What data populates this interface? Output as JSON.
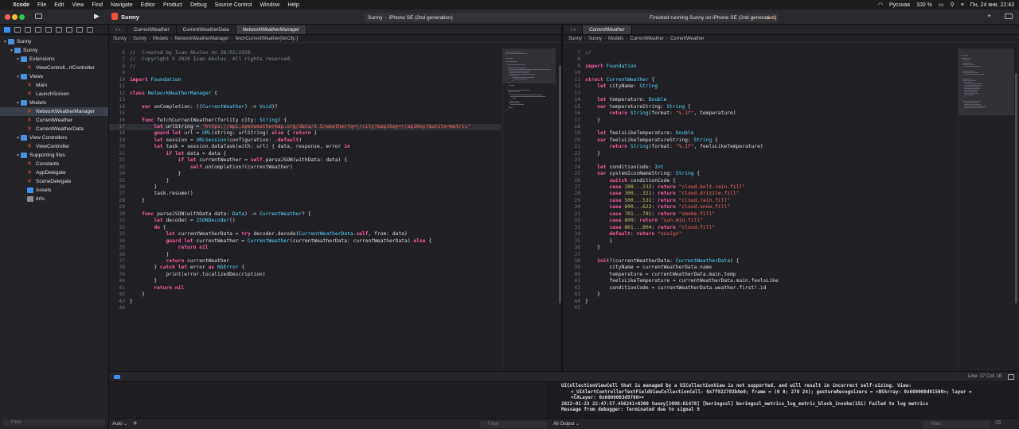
{
  "menubar": {
    "items": [
      "Xcode",
      "File",
      "Edit",
      "View",
      "Find",
      "Navigate",
      "Editor",
      "Product",
      "Debug",
      "Source Control",
      "Window",
      "Help"
    ],
    "status": {
      "input_source": "Русская",
      "battery": "100 %",
      "datetime": "Пн, 24 янв.  22:43"
    }
  },
  "toolbar": {
    "project": "Sunny",
    "scheme": "Sunny",
    "device": "iPhone SE (2nd generation)",
    "run_status": "Finished running Sunny on iPhone SE (2nd generation)",
    "warning_count": "1"
  },
  "navigator": {
    "tree": [
      {
        "label": "Sunny",
        "depth": 0,
        "kind": "proj",
        "open": true
      },
      {
        "label": "Sunny",
        "depth": 1,
        "kind": "folder",
        "open": true
      },
      {
        "label": "Extensions",
        "depth": 2,
        "kind": "folder",
        "open": true
      },
      {
        "label": "ViewControll...rtController",
        "depth": 3,
        "kind": "swift"
      },
      {
        "label": "Views",
        "depth": 2,
        "kind": "folder",
        "open": true
      },
      {
        "label": "Main",
        "depth": 3,
        "kind": "swift"
      },
      {
        "label": "LaunchScreen",
        "depth": 3,
        "kind": "swift"
      },
      {
        "label": "Models",
        "depth": 2,
        "kind": "folder",
        "open": true
      },
      {
        "label": "NetworkWeatherManager",
        "depth": 3,
        "kind": "swift",
        "selected": true
      },
      {
        "label": "CurrentWeather",
        "depth": 3,
        "kind": "swift"
      },
      {
        "label": "CurrentWeatherData",
        "depth": 3,
        "kind": "swift"
      },
      {
        "label": "View Controllers",
        "depth": 2,
        "kind": "folder",
        "open": true
      },
      {
        "label": "ViewController",
        "depth": 3,
        "kind": "swift"
      },
      {
        "label": "Supporting files",
        "depth": 2,
        "kind": "folder",
        "open": true
      },
      {
        "label": "Constants",
        "depth": 3,
        "kind": "swift"
      },
      {
        "label": "AppDelegate",
        "depth": 3,
        "kind": "swift"
      },
      {
        "label": "SceneDelegate",
        "depth": 3,
        "kind": "swift"
      },
      {
        "label": "Assets",
        "depth": 3,
        "kind": "assets"
      },
      {
        "label": "Info",
        "depth": 3,
        "kind": "plist"
      }
    ],
    "filter_placeholder": "Filter"
  },
  "left_editor": {
    "tabs": [
      "CurrentWeather",
      "CurrentWeatherData",
      "NetworkWeatherManager"
    ],
    "active_tab": 2,
    "breadcrumb": [
      "Sunny",
      "Sunny",
      "Models",
      "NetworkWeatherManager",
      "fetchCurrentWeather(forCity:)"
    ],
    "first_line": 6,
    "current_line": 17,
    "lines": [
      "//  Created by Ivan Akulov on 28/02/2020.",
      "//  Copyright © 2020 Ivan Akulov. All rights reserved.",
      "//",
      "",
      "import Foundation",
      "",
      "class NetworkWeatherManager {",
      "",
      "    var onCompletion: ((CurrentWeather) -> Void)?",
      "",
      "    func fetchCurrentWeather(forCity city: String) {",
      "        let urlString = \"https://api.openweathermap.org/data/2.5/weather?q=\\(city)&apikey=\\(apiKey)&units=metric\"",
      "        guard let url = URL(string: urlString) else { return }",
      "        let session = URLSession(configuration: .default)",
      "        let task = session.dataTask(with: url) { data, response, error in",
      "            if let data = data {",
      "                if let currentWeather = self.parseJSON(withData: data) {",
      "                    self.onCompletion?(currentWeather)",
      "                }",
      "            }",
      "        }",
      "        task.resume()",
      "    }",
      "",
      "    func parseJSON(withData data: Data) -> CurrentWeather? {",
      "        let decoder = JSONDecoder()",
      "        do {",
      "            let currentWeatherData = try decoder.decode(CurrentWeatherData.self, from: data)",
      "            guard let currentWeather = CurrentWeather(currentWeatherData: currentWeatherData) else {",
      "                return nil",
      "            }",
      "            return currentWeather",
      "        } catch let error as NSError {",
      "            print(error.localizedDescription)",
      "        }",
      "        return nil",
      "    }",
      "}",
      ""
    ]
  },
  "right_editor": {
    "tabs": [
      "CurrentWeather"
    ],
    "breadcrumb": [
      "Sunny",
      "Sunny",
      "Models",
      "CurrentWeather",
      "CurrentWeather"
    ],
    "first_line": 7,
    "lines": [
      "//",
      "",
      "import Foundation",
      "",
      "struct CurrentWeather {",
      "    let cityName: String",
      "",
      "    let temperature: Double",
      "    var temperatureString: String {",
      "        return String(format: \"%.1f\", temperature)",
      "    }",
      "",
      "    let feelsLikeTemperature: Double",
      "    var feelsLikeTemperatureString: String {",
      "        return String(format: \"%.1f\", feelsLikeTemperature)",
      "    }",
      "",
      "    let conditionCode: Int",
      "    var systemIconNameString: String {",
      "        switch conditionCode {",
      "        case 200...232: return \"cloud.bolt.rain.fill\"",
      "        case 300...321: return \"cloud.drizzle.fill\"",
      "        case 500...531: return \"cloud.rain.fill\"",
      "        case 600...622: return \"cloud.snow.fill\"",
      "        case 701...781: return \"smoke.fill\"",
      "        case 800: return \"sun.min.fill\"",
      "        case 801...804: return \"cloud.fill\"",
      "        default: return \"nosign\"",
      "        }",
      "    }",
      "",
      "    init?(currentWeatherData: CurrentWeatherData) {",
      "        cityName = currentWeatherData.name",
      "        temperature = currentWeatherData.main.temp",
      "        feelsLikeTemperature = currentWeatherData.main.feelsLike",
      "        conditionCode = currentWeatherData.weather.first!.id",
      "    }",
      "}",
      ""
    ]
  },
  "debug": {
    "line_col": "Line: 17  Col: 18",
    "console_lines": [
      "UICollectionViewCell that is managed by a UICollectionView is not supported, and will result in incorrect self-sizing. View:",
      "<_UIAlertControllerTextFieldViewCollectionCell: 0x7f922783b8e0; frame = (0 0; 270 24); gestureRecognizers = <NSArray: 0x600000d01500>; layer =",
      "<CALayer: 0x6000003d9700>>",
      "2022-01-23 22:47:57.456241+0300 Sunny[2098:61478] [boringssl] boringssl_metrics_log_metric_block_invoke(151) Failed to log metrics",
      "Message from debugger: Terminated due to signal 9"
    ],
    "auto_label": "Auto",
    "output_label": "All Output",
    "filter_placeholder": "Filter"
  }
}
